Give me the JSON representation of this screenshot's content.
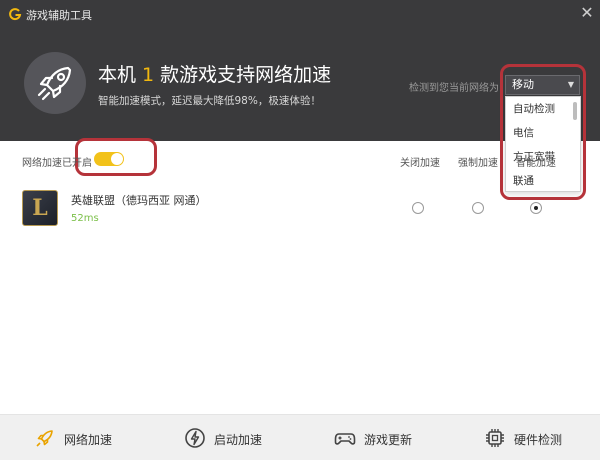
{
  "window": {
    "title": "游戏辅助工具",
    "close_glyph": "✕"
  },
  "hero": {
    "headline_prefix": "本机",
    "game_count": "1",
    "headline_suffix": "款游戏支持网络加速",
    "subline": "智能加速模式，延迟最大降低98%，极速体验！",
    "icon": "rocket-icon"
  },
  "network": {
    "label": "检测到您当前网络为",
    "selected": "移动",
    "options": [
      "自动检测",
      "电信",
      "方正宽带",
      "联通"
    ]
  },
  "settings": {
    "toggle_label": "网络加速已开启",
    "toggle_on": true,
    "columns": [
      "关闭加速",
      "强制加速",
      "智能加速"
    ]
  },
  "games": [
    {
      "name": "英雄联盟（德玛西亚 网通）",
      "ping": "52ms",
      "icon_letter": "L",
      "mode_index": 2
    }
  ],
  "bottom_tabs": [
    {
      "label": "网络加速",
      "icon": "rocket-icon",
      "active": true
    },
    {
      "label": "启动加速",
      "icon": "lightning-icon",
      "active": false
    },
    {
      "label": "游戏更新",
      "icon": "gamepad-icon",
      "active": false
    },
    {
      "label": "硬件检测",
      "icon": "chip-icon",
      "active": false
    }
  ],
  "colors": {
    "header_bg": "#3a3a3c",
    "accent": "#f2b80f",
    "annotation": "#b5333a",
    "ping_green": "#7cc04a"
  }
}
